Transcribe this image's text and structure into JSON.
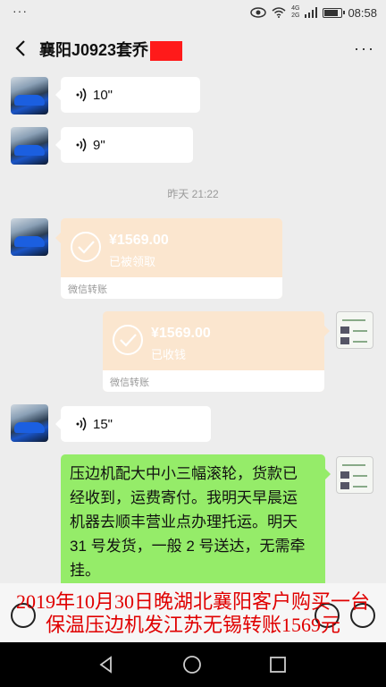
{
  "status": {
    "dots": "···",
    "net_top": "4G",
    "net_bottom": "2G",
    "time": "08:58",
    "battery_level": 0.75
  },
  "header": {
    "title": "襄阳J0923套乔",
    "more": "···"
  },
  "messages": [
    {
      "type": "voice",
      "side": "left",
      "duration": "10\""
    },
    {
      "type": "voice",
      "side": "left",
      "duration": "9\""
    },
    {
      "type": "time",
      "text": "昨天 21:22"
    },
    {
      "type": "transfer",
      "side": "left",
      "amount": "¥1569.00",
      "status": "已被领取",
      "footer": "微信转账"
    },
    {
      "type": "transfer",
      "side": "right",
      "amount": "¥1569.00",
      "status": "已收钱",
      "footer": "微信转账"
    },
    {
      "type": "voice",
      "side": "left",
      "duration": "15\""
    },
    {
      "type": "text",
      "side": "right",
      "lines": [
        "压边机配大中小三幅滚轮，货款已",
        "经收到，运费寄付。我明天早晨运",
        "机器去顺丰营业点办理托运。明天",
        "31 号发货，一般 2 号送达，无需牵",
        "挂。"
      ]
    }
  ],
  "overlay": {
    "line1": "2019年10月30日晚湖北襄阳客户购买一台",
    "line2": "保温压边机发江苏无锡转账1569元"
  },
  "icons": [
    "back-arrow-icon",
    "more-icon",
    "voice-wave-icon",
    "check-circle-icon",
    "voice-input-icon",
    "emoji-icon",
    "plus-icon",
    "nav-back-icon",
    "nav-home-icon",
    "nav-recent-icon",
    "eye-icon",
    "wifi-icon",
    "signal-icon",
    "battery-icon"
  ]
}
